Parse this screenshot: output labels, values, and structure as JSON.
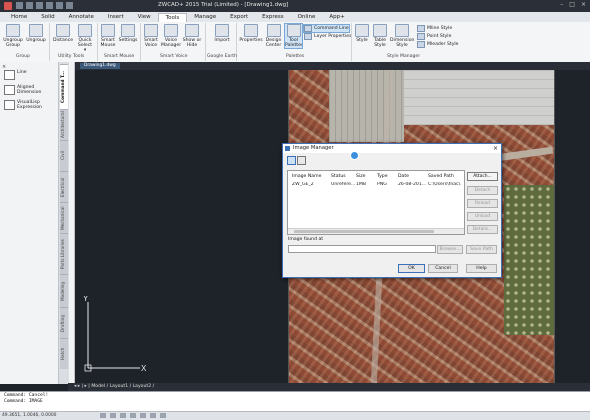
{
  "window": {
    "title": "ZWCAD+ 2015 Trial (Limited) - [Drawing1.dwg]",
    "controls": [
      "–",
      "□",
      "×"
    ]
  },
  "ribbon_tabs": [
    "Home",
    "Solid",
    "Annotate",
    "Insert",
    "View",
    "Tools",
    "Manage",
    "Export",
    "Express",
    "Online",
    "App+"
  ],
  "active_tab": "Tools",
  "ribbon": {
    "group": {
      "title": "Group",
      "ungroup_top": "Ungroup",
      "ungroup_bottom": "Group",
      "ungroup2": "Ungroup"
    },
    "utility": {
      "title": "Utility Tools",
      "distance": "Distance",
      "quick_select": "Quick Select",
      "quick_select_caret": "▾"
    },
    "smart_mouse": {
      "title": "Smart Mouse",
      "mouse": "Smart Mouse",
      "settings": "Settings"
    },
    "smart_voice": {
      "title": "Smart Voice",
      "voice": "Smart Voice",
      "voice_manager": "Voice Manager",
      "show_hide": "Show or Hide"
    },
    "google_earth": {
      "title": "Google Earth",
      "import": "Import"
    },
    "palettes": {
      "title": "Palettes",
      "properties": "Properties",
      "design_center": "Design Center",
      "tool_palettes": "Tool Palettes",
      "command_line": "Command Line",
      "layer_properties": "Layer Properties"
    },
    "style_manager": {
      "title": "Style Manager",
      "style": "Style",
      "table_style": "Table Style",
      "dimension_style": "Dimension Style",
      "mline_style": "Mline Style",
      "point_style": "Point Style",
      "mleader_style": "Mleader Style"
    }
  },
  "doc_tab": "Drawing1.dwg",
  "palette": {
    "items": [
      "Line",
      "Aligned Dimension",
      "VisualLisp Expression"
    ],
    "tabs": [
      "Command T...",
      "Architectural",
      "Civil",
      "Electrical",
      "Mechanical",
      "Parts Libraries",
      "Modeling",
      "Drafting",
      "Hatch"
    ]
  },
  "ucs": {
    "x": "X",
    "y": "Y"
  },
  "layout_tabs": "◂ ▸ | ▸ | Model / Layout1 / Layout2 /",
  "command": {
    "lines": [
      "Command: Cancel!",
      "Command: IMAGE"
    ]
  },
  "status": {
    "coords": "49.3651, 1.0046, 0.0000"
  },
  "image_manager": {
    "title": "Image Manager",
    "columns": [
      "Image Name",
      "Status",
      "Size",
      "Type",
      "Date",
      "Saved Path"
    ],
    "rows": [
      {
        "name": "ZW_GE_2",
        "status": "Unrefere...",
        "size": "1MB",
        "type": "PNG",
        "date": "26-08-201...",
        "path": "C:\\Users\\fnac\\..."
      }
    ],
    "side_buttons": [
      "Attach...",
      "Detach",
      "Reload",
      "Unload",
      "Details..."
    ],
    "found_at_label": "Image found at",
    "browse": "Browse...",
    "save_path": "Save Path",
    "ok": "OK",
    "cancel": "Cancel",
    "help": "Help"
  },
  "colors": {
    "accent": "#3c70b8",
    "canvas": "#1e2229"
  }
}
